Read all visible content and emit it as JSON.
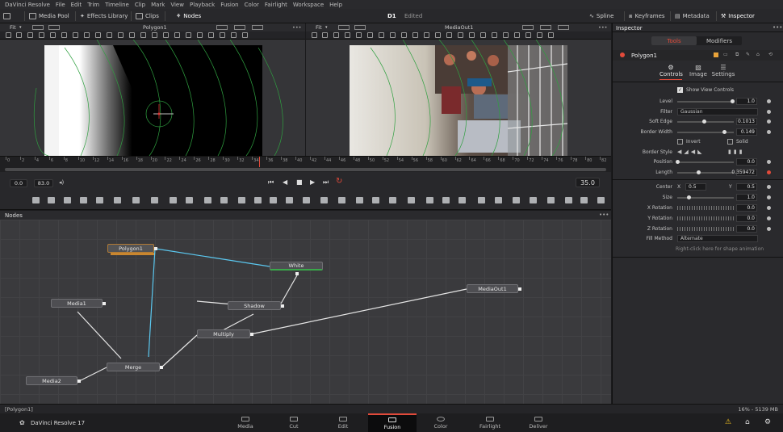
{
  "menubar": [
    "DaVinci Resolve",
    "File",
    "Edit",
    "Trim",
    "Timeline",
    "Clip",
    "Mark",
    "View",
    "Playback",
    "Fusion",
    "Color",
    "Fairlight",
    "Workspace",
    "Help"
  ],
  "toolbar": {
    "media_pool": "Media Pool",
    "effects_library": "Effects Library",
    "clips": "Clips",
    "nodes": "Nodes",
    "comp_name": "D1",
    "comp_status": "Edited",
    "spline": "Spline",
    "keyframes": "Keyframes",
    "metadata": "Metadata",
    "inspector": "Inspector"
  },
  "viewer_left": {
    "fit": "Fit",
    "title": "Polygon1"
  },
  "viewer_right": {
    "fit": "Fit",
    "title": "MediaOut1"
  },
  "ruler_ticks": [
    "0",
    "2",
    "4",
    "6",
    "8",
    "10",
    "12",
    "14",
    "16",
    "18",
    "20",
    "22",
    "24",
    "26",
    "28",
    "30",
    "32",
    "34",
    "36",
    "38",
    "40",
    "42",
    "44",
    "46",
    "48",
    "50",
    "52",
    "54",
    "56",
    "58",
    "60",
    "62",
    "64",
    "66",
    "68",
    "70",
    "72",
    "74",
    "76",
    "78",
    "80",
    "82"
  ],
  "transport": {
    "start": "0.0",
    "end": "83.0",
    "current": "35.0"
  },
  "nodes_panel": {
    "title": "Nodes",
    "nodes": [
      "Polygon1",
      "White",
      "Shadow",
      "Media1",
      "Multiply",
      "MediaOut1",
      "Merge",
      "Media2"
    ]
  },
  "status": {
    "selection": "[Polygon1]",
    "memory": "16% - 5139 MB"
  },
  "pages": [
    "Media",
    "Cut",
    "Edit",
    "Fusion",
    "Color",
    "Fairlight",
    "Deliver"
  ],
  "active_page": "Fusion",
  "product": "DaVinci Resolve 17",
  "inspector": {
    "title": "Inspector",
    "tabs": [
      "Tools",
      "Modifiers"
    ],
    "node_name": "Polygon1",
    "subtabs": [
      "Controls",
      "Image",
      "Settings"
    ],
    "show_view_controls": "Show View Controls",
    "level": {
      "label": "Level",
      "value": "1.0"
    },
    "filter": {
      "label": "Filter",
      "value": "Gaussian"
    },
    "soft_edge": {
      "label": "Soft Edge",
      "value": "0.1013"
    },
    "border_width": {
      "label": "Border Width",
      "value": "0.149"
    },
    "invert": "Invert",
    "solid": "Solid",
    "border_style": "Border Style",
    "position": {
      "label": "Position",
      "value": "0.0"
    },
    "length": {
      "label": "Length",
      "value": "0.359472"
    },
    "center": {
      "label": "Center",
      "x_label": "X",
      "x": "0.5",
      "y_label": "Y",
      "y": "0.5"
    },
    "size": {
      "label": "Size",
      "value": "1.0"
    },
    "x_rotation": {
      "label": "X Rotation",
      "value": "0.0"
    },
    "y_rotation": {
      "label": "Y Rotation",
      "value": "0.0"
    },
    "z_rotation": {
      "label": "Z Rotation",
      "value": "0.0"
    },
    "fill_method": {
      "label": "Fill Method",
      "value": "Alternate"
    },
    "hint": "Right-click here for shape animation"
  },
  "colors": {
    "accent_red": "#e24a3a",
    "link_blue": "#5bc8f0",
    "spline_green": "#3aa84a"
  }
}
